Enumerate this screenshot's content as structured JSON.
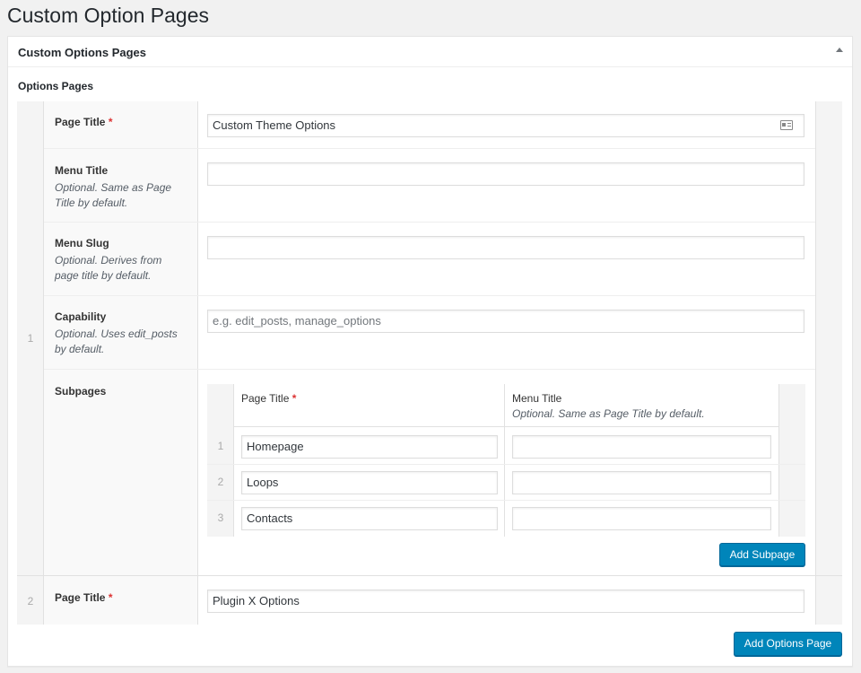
{
  "page": {
    "title": "Custom Option Pages"
  },
  "postbox": {
    "title": "Custom Options Pages"
  },
  "section": {
    "label": "Options Pages"
  },
  "rows": [
    {
      "number": "1",
      "page_title": {
        "label": "Page Title",
        "required": "*",
        "value": "Custom Theme Options"
      },
      "menu_title": {
        "label": "Menu Title",
        "description": "Optional. Same as Page Title by default.",
        "value": ""
      },
      "menu_slug": {
        "label": "Menu Slug",
        "description": "Optional. Derives from page title by default.",
        "value": ""
      },
      "capability": {
        "label": "Capability",
        "description": "Optional. Uses edit_posts by default.",
        "placeholder": "e.g. edit_posts, manage_options"
      },
      "subpages": {
        "label": "Subpages",
        "columns": [
          {
            "label": "Page Title",
            "required": "*"
          },
          {
            "label": "Menu Title",
            "description": "Optional. Same as Page Title by default."
          }
        ],
        "items": [
          {
            "number": "1",
            "page_title": "Homepage",
            "menu_title": ""
          },
          {
            "number": "2",
            "page_title": "Loops",
            "menu_title": ""
          },
          {
            "number": "3",
            "page_title": "Contacts",
            "menu_title": ""
          }
        ],
        "add_label": "Add Subpage"
      }
    },
    {
      "number": "2",
      "page_title": {
        "label": "Page Title",
        "required": "*",
        "value": "Plugin X Options"
      }
    }
  ],
  "add_options_page_label": "Add Options Page",
  "icons": {
    "toggle": "triangle-up-icon",
    "contact_card": "contact-card-icon"
  },
  "colors": {
    "primary_button": "#0085ba",
    "required": "#dc3232"
  }
}
